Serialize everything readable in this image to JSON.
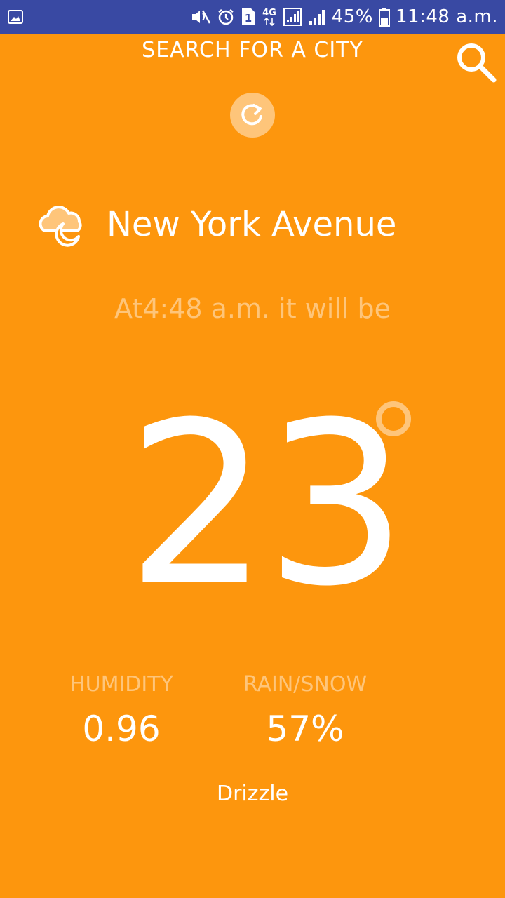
{
  "status_bar": {
    "battery": "45%",
    "time": "11:48 a.m.",
    "network": "4G",
    "sim_slot": "1",
    "icons": [
      "gallery-icon",
      "mute-icon",
      "alarm-icon",
      "sim-icon",
      "4g-icon",
      "signal-icon",
      "signal-icon",
      "battery-icon"
    ]
  },
  "header": {
    "search_label": "SEARCH FOR A CITY",
    "search_icon": "search-icon",
    "refresh_icon": "refresh-icon"
  },
  "location": {
    "name": "New York Avenue",
    "weather_icon": "cloud-moon-icon"
  },
  "forecast": {
    "time_text": "At4:48 a.m. it will be",
    "temperature": "23",
    "degree_icon": "degree-icon"
  },
  "metrics": {
    "humidity_label": "HUMIDITY",
    "humidity_value": "0.96",
    "rain_label": "RAIN/SNOW",
    "rain_value": "57%"
  },
  "summary": "Drizzle",
  "colors": {
    "background": "#FD960D",
    "status_bar": "#3949A3",
    "muted_text": "#FEC57A",
    "text": "#FFFFFF"
  }
}
